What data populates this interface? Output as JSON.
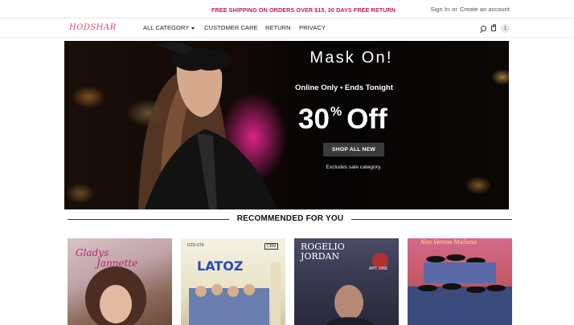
{
  "topbar": {
    "promo": "FREE SHIPPING ON ORDERS OVER $15, 30 DAYS FREE RETURN",
    "sign_in": "Sign In",
    "or": "or",
    "create_account": "Create an account"
  },
  "nav": {
    "logo": "HODSHAR",
    "items": [
      "ALL CATEGORY",
      "CUSTOMER CARE",
      "RETURN",
      "PRIVACY"
    ],
    "cart_count": "1"
  },
  "hero": {
    "title": "Mask On!",
    "subtitle": "Online Only • Ends Tonight",
    "offer_value": "30",
    "offer_percent": "%",
    "offer_word": "Off",
    "cta": "SHOP ALL NEW",
    "note": "Excludes sale category."
  },
  "section": {
    "title": "RECOMMENDED FOR YOU"
  },
  "products": [
    {
      "line1": "Gladys",
      "line2": "Jannette"
    },
    {
      "brand": "LATOZ",
      "code": "GTD-079",
      "badge": "CRM"
    },
    {
      "line1": "ROGELIO",
      "line2": "JORDAN",
      "code": "APC 1068"
    },
    {
      "title": "Nos Vemos Mañana"
    }
  ],
  "colors": {
    "accent": "#c2185b",
    "cta_bg": "#3b3b3b"
  },
  "icons": [
    "search-icon",
    "bag-icon"
  ]
}
